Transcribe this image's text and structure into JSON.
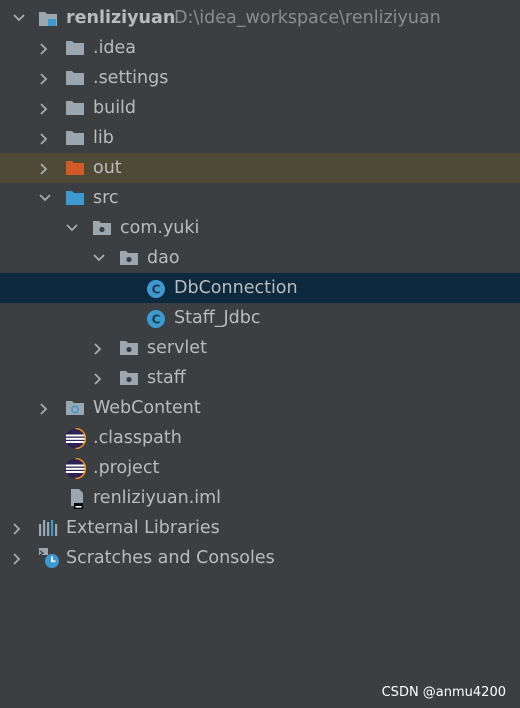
{
  "project": {
    "name": "renliziyuan",
    "path": "D:\\idea_workspace\\renliziyuan"
  },
  "items": {
    "idea": ".idea",
    "settings": ".settings",
    "build": "build",
    "lib": "lib",
    "out": "out",
    "src": "src",
    "com_yuki": "com.yuki",
    "dao": "dao",
    "dbconnection": "DbConnection",
    "staff_jdbc": "Staff_Jdbc",
    "servlet": "servlet",
    "staff": "staff",
    "webcontent": "WebContent",
    "classpath": ".classpath",
    "project_file": ".project",
    "iml": "renliziyuan.iml",
    "external_libraries": "External Libraries",
    "scratches": "Scratches and Consoles"
  },
  "class_badge_letter": "C",
  "colors": {
    "background": "#3c3f41",
    "selection": "#0d293e",
    "excluded_highlight": "#4f4a36",
    "folder": "#9aa7b0",
    "excluded_folder": "#d35a27",
    "source_folder": "#3d9ad1",
    "class_badge": "#3d9ad1"
  },
  "watermark": "CSDN @anmu4200"
}
